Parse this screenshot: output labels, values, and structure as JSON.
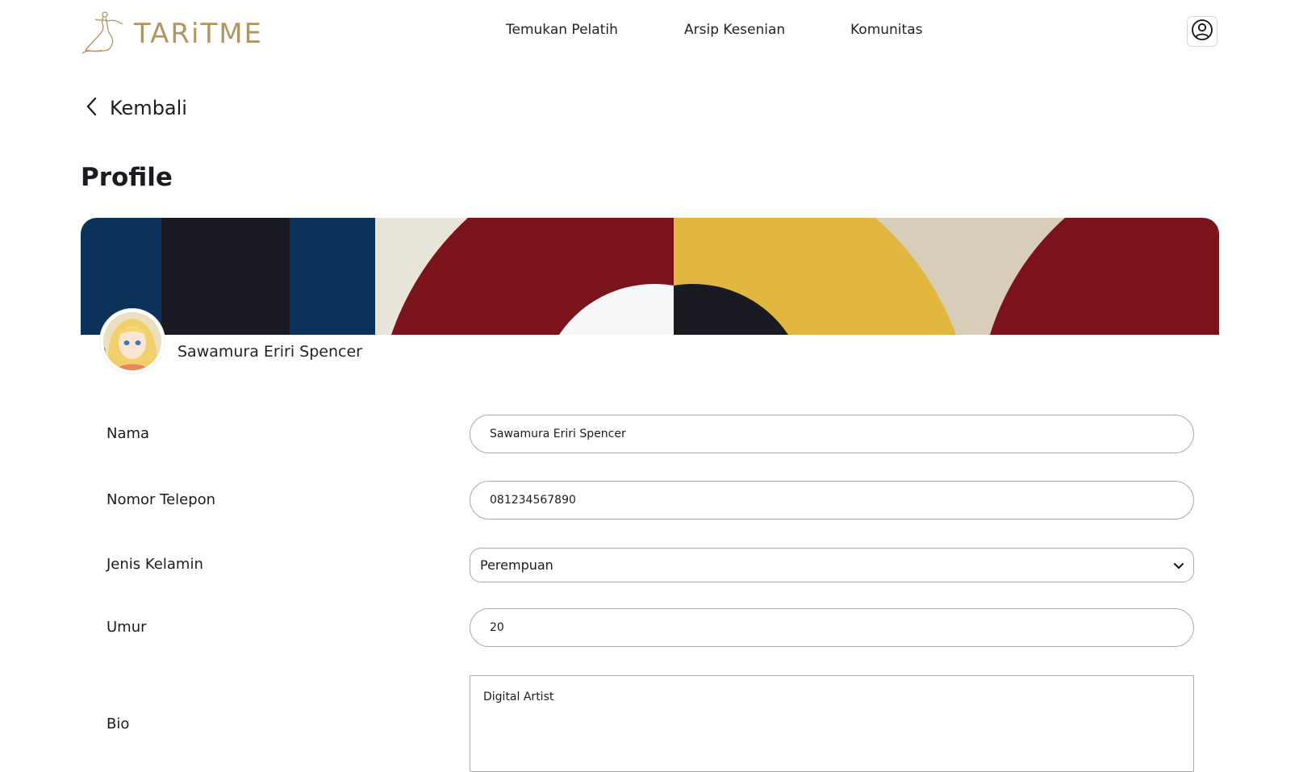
{
  "brand": {
    "name": "TARiTME",
    "color": "#b2955f"
  },
  "nav": {
    "items": [
      {
        "label": "Temukan Pelatih"
      },
      {
        "label": "Arsip Kesenian"
      },
      {
        "label": "Komunitas"
      }
    ],
    "user_icon": "user-circle-icon"
  },
  "back": {
    "label": "Kembali",
    "icon": "chevron-left-icon"
  },
  "page": {
    "title": "Profile"
  },
  "profile": {
    "display_name": "Sawamura Eriri Spencer"
  },
  "banner_colors": {
    "navy": "#0b3259",
    "dark": "#1a1a22",
    "cream": "#e8e4da",
    "red": "#7a141a",
    "gold": "#e1b73d",
    "beige": "#d8cdb9",
    "white": "#f6f7f9"
  },
  "form": {
    "nama": {
      "label": "Nama",
      "value": "Sawamura Eriri Spencer"
    },
    "telepon": {
      "label": "Nomor Telepon",
      "value": "081234567890"
    },
    "jenis_kelamin": {
      "label": "Jenis Kelamin",
      "value": "Perempuan"
    },
    "umur": {
      "label": "Umur",
      "value": "20"
    },
    "bio": {
      "label": "Bio",
      "value": "Digital Artist"
    }
  }
}
